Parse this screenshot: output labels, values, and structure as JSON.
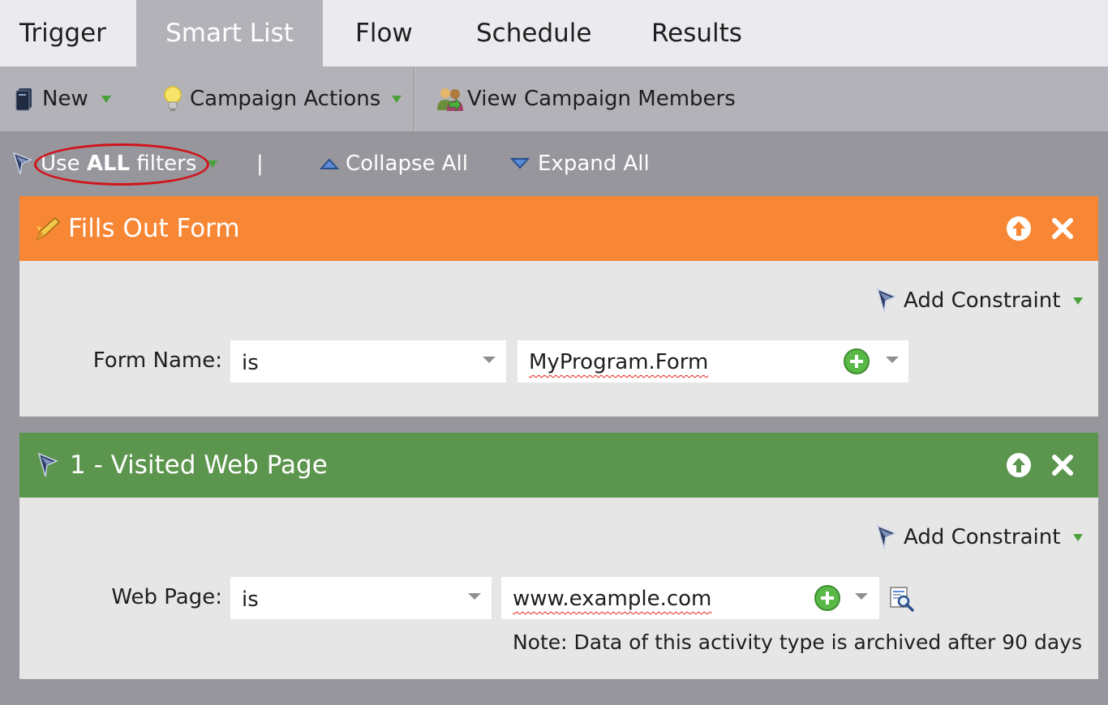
{
  "tabs": [
    {
      "label": "Trigger",
      "active": false
    },
    {
      "label": "Smart List",
      "active": true
    },
    {
      "label": "Flow",
      "active": false
    },
    {
      "label": "Schedule",
      "active": false
    },
    {
      "label": "Results",
      "active": false
    }
  ],
  "toolbar": {
    "new_label": "New",
    "campaign_actions_label": "Campaign Actions",
    "view_members_label": "View Campaign Members"
  },
  "filterbar": {
    "use_prefix": "Use ",
    "use_bold": "ALL",
    "use_suffix": " filters",
    "separator": "|",
    "collapse_label": "Collapse All",
    "expand_label": "Expand All"
  },
  "filters": [
    {
      "title": "Fills Out Form",
      "header_color": "#f88735",
      "add_constraint_label": "Add Constraint",
      "field_label": "Form Name:",
      "operator": "is",
      "value": "MyProgram.Form"
    },
    {
      "title": "1 - Visited Web Page",
      "header_color": "#5c954d",
      "add_constraint_label": "Add Constraint",
      "field_label": "Web Page:",
      "operator": "is",
      "value": "www.example.com",
      "note": "Note: Data of this activity type is archived after 90 days"
    }
  ],
  "colors": {
    "background": "#96969c",
    "toolbar": "#b2b2b8",
    "tabbar": "#ebebef",
    "card_body": "#e6e6e6",
    "highlight_circle": "#d2141b",
    "accent_green": "#4aa13a"
  }
}
